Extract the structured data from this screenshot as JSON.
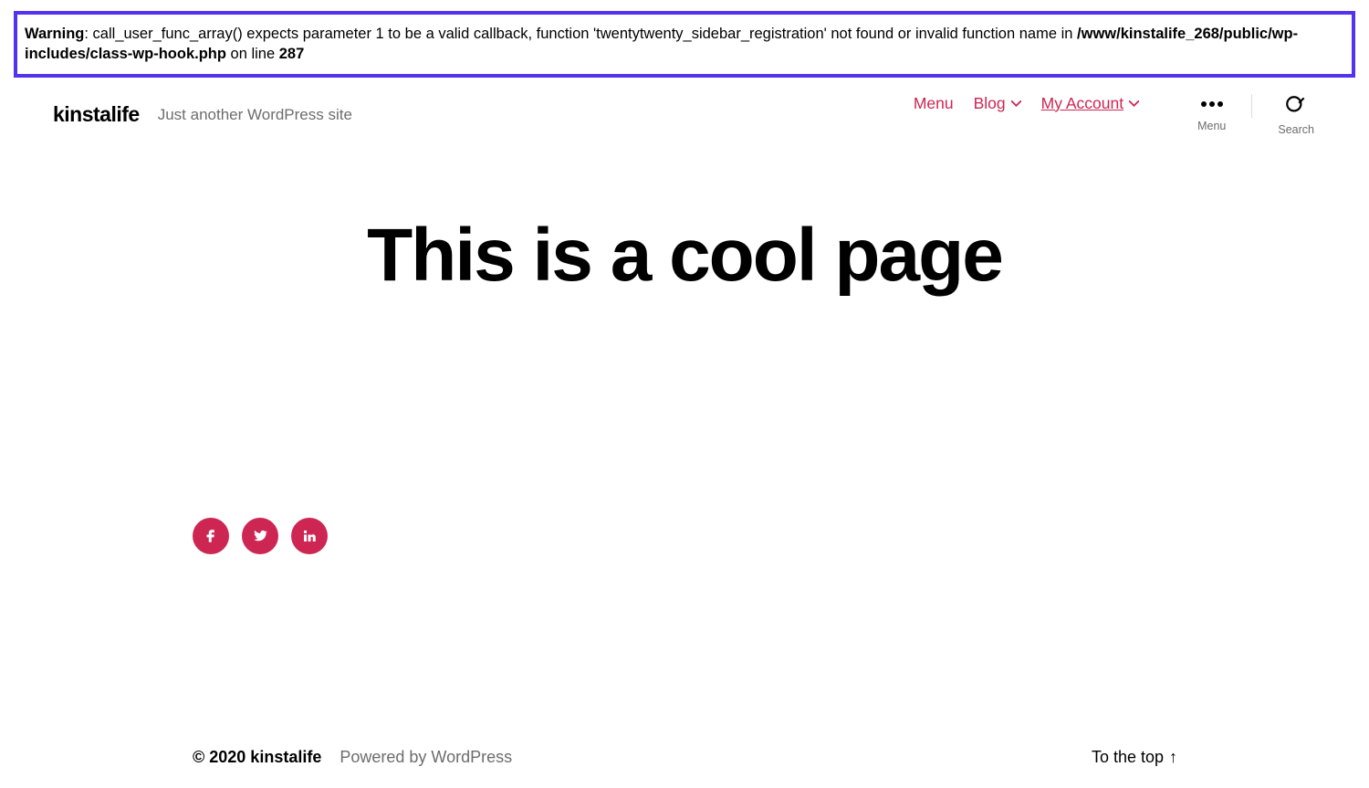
{
  "warning": {
    "label": "Warning",
    "message": ": call_user_func_array() expects parameter 1 to be a valid callback, function 'twentytwenty_sidebar_registration' not found or invalid function name in ",
    "path": "/www/kinstalife_268/public/wp-includes/class-wp-hook.php",
    "on_line": " on line ",
    "line": "287"
  },
  "header": {
    "site_title": "kinstalife",
    "tagline": "Just another WordPress site",
    "nav": {
      "menu": "Menu",
      "blog": "Blog",
      "my_account": "My Account"
    },
    "tools": {
      "menu_label": "Menu",
      "search_label": "Search"
    }
  },
  "main": {
    "title": "This is a cool page"
  },
  "social": {
    "facebook": "facebook-icon",
    "twitter": "twitter-icon",
    "linkedin": "linkedin-icon"
  },
  "footer": {
    "copyright": "© 2020 kinstalife",
    "powered": "Powered by WordPress",
    "to_top": "To the top"
  }
}
